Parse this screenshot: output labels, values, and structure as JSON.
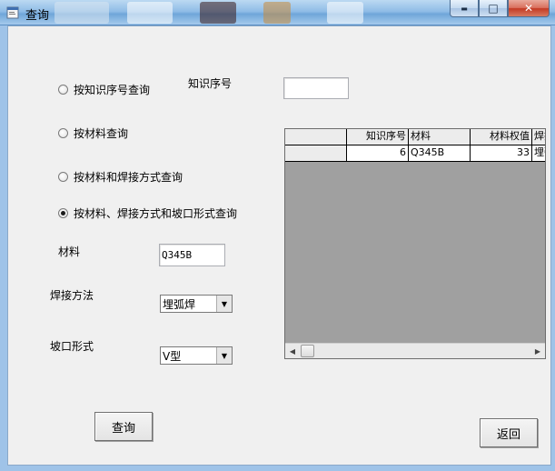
{
  "window": {
    "title": "查询",
    "min_glyph": "▬",
    "max_glyph": "□",
    "close_glyph": "✕"
  },
  "radios": [
    {
      "label": "按知识序号查询",
      "checked": false
    },
    {
      "label": "按材料查询",
      "checked": false
    },
    {
      "label": "按材料和焊接方式查询",
      "checked": false
    },
    {
      "label": "按材料、焊接方式和坡口形式查询",
      "checked": true
    }
  ],
  "knowledge_no": {
    "label": "知识序号",
    "value": ""
  },
  "material": {
    "label": "材料",
    "value": "Q345B"
  },
  "weld_method": {
    "label": "焊接方法",
    "value": "埋弧焊"
  },
  "groove_form": {
    "label": "坡口形式",
    "value": "V型"
  },
  "grid": {
    "headers": [
      "",
      "知识序号",
      "材料",
      "材料权值",
      "焊接"
    ],
    "rows": [
      [
        "",
        "6",
        "Q345B",
        "33",
        "埋弧"
      ]
    ]
  },
  "buttons": {
    "query": "查询",
    "back": "返回"
  },
  "icons": {
    "dropdown": "▼",
    "scroll_left": "◀",
    "scroll_right": "▶"
  }
}
